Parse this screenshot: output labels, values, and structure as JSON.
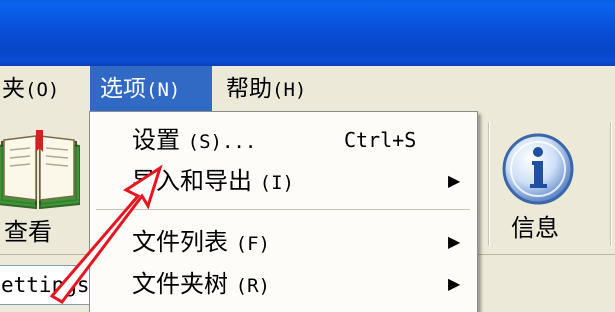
{
  "menubar": {
    "file_label": "夹",
    "file_accel": "(O)",
    "options_label": "选项",
    "options_accel": "(N)",
    "help_label": "帮助",
    "help_accel": "(H)"
  },
  "toolbar": {
    "view_label": "查看",
    "info_label": "信息"
  },
  "pathbar": {
    "value": "ettings"
  },
  "options_menu": {
    "items": [
      {
        "label": "设置",
        "accel": "(S)",
        "suffix": "...",
        "shortcut": "Ctrl+S",
        "submenu": false
      },
      {
        "label": "导入和导出",
        "accel": "(I)",
        "suffix": "",
        "shortcut": "",
        "submenu": true
      },
      {
        "label": "文件列表",
        "accel": "(F)",
        "suffix": "",
        "shortcut": "",
        "submenu": true
      },
      {
        "label": "文件夹树",
        "accel": "(R)",
        "suffix": "",
        "shortcut": "",
        "submenu": true
      }
    ]
  },
  "colors": {
    "menu_highlight": "#316ac5",
    "annotation_arrow": "#e8141e",
    "titlebar": "#0a4fd6"
  },
  "icons": {
    "submenu": "triangle-right",
    "view": "open-book-icon",
    "info": "info-icon"
  }
}
